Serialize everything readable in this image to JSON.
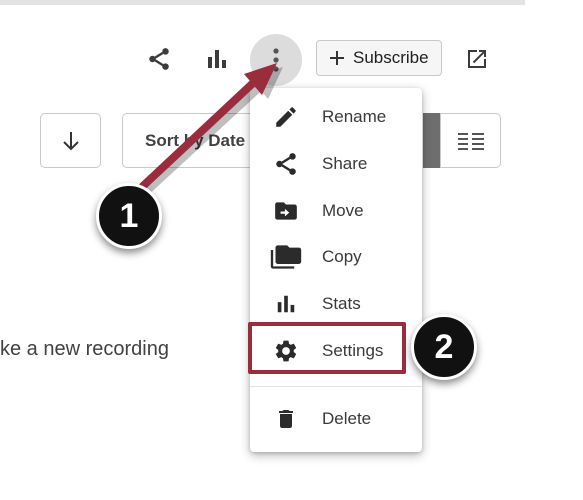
{
  "toolbar": {
    "share_icon": "share-icon",
    "stats_icon": "bar-chart-icon",
    "more_icon": "more-vert-icon",
    "subscribe_label": "Subscribe",
    "subscribe_icon": "plus-icon",
    "open_external_icon": "open-in-new-icon"
  },
  "list_controls": {
    "download_icon": "arrow-down-icon",
    "sort_label": "Sort by Date",
    "view_icon": "list-view-icon"
  },
  "main": {
    "empty_text": "ke a new recording"
  },
  "menu": {
    "items": [
      {
        "label": "Rename",
        "icon": "pencil-icon"
      },
      {
        "label": "Share",
        "icon": "share-icon"
      },
      {
        "label": "Move",
        "icon": "folder-move-icon"
      },
      {
        "label": "Copy",
        "icon": "copy-folder-icon"
      },
      {
        "label": "Stats",
        "icon": "bar-chart-icon"
      },
      {
        "label": "Settings",
        "icon": "gear-icon"
      },
      {
        "label": "Delete",
        "icon": "trash-icon"
      }
    ]
  },
  "annotations": {
    "callout_1": "1",
    "callout_2": "2",
    "accent_color": "#9b2c3e"
  }
}
